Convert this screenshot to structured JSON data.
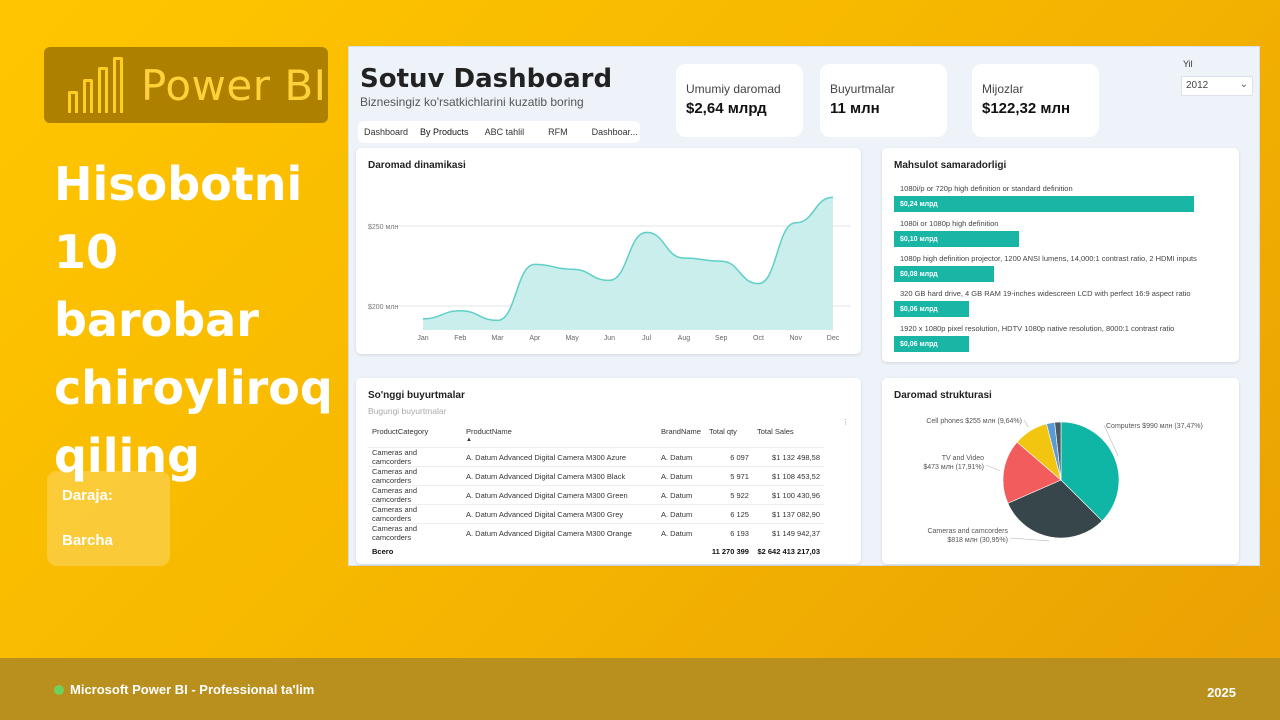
{
  "logo": {
    "text": "Power BI",
    "icon": "power-bi-logo-icon",
    "color": "#ffd23a"
  },
  "headline": {
    "lines": [
      "Hisobotni",
      "10 barobar",
      "chiroyliroq",
      "qiling"
    ]
  },
  "level": {
    "label": "Daraja:",
    "value": "Barcha"
  },
  "footer": {
    "left": "Microsoft Power BI  -  Professional ta'lim",
    "year": "2025",
    "dot_color": "#6fd05c"
  },
  "dashboard": {
    "title": "Sotuv Dashboard",
    "subtitle": "Biznesingiz ko'rsatkichlarini kuzatib boring",
    "tabs": [
      "Dashboard",
      "By Products",
      "ABC tahlil",
      "RFM",
      "Dashboar..."
    ],
    "kpis": [
      {
        "label": "Umumiy daromad",
        "value": "$2,64 млрд"
      },
      {
        "label": "Buyurtmalar",
        "value": "11 млн"
      },
      {
        "label": "Mijozlar",
        "value": "$122,32 млн"
      }
    ],
    "year_filter": {
      "label": "Yil",
      "value": "2012"
    },
    "revenue_chart": {
      "title": "Daromad dinamikasi",
      "color": "#5fcfc7"
    },
    "products": {
      "title": "Mahsulot samaradorligi",
      "color": "#19b6a6",
      "items": [
        {
          "label": "1080i/p or 720p high definition or standard definition",
          "value_label": "$0,24 млрд",
          "value": 0.24
        },
        {
          "label": "1080i or 1080p high definition",
          "value_label": "$0,10 млрд",
          "value": 0.1
        },
        {
          "label": "1080p high definition projector, 1200 ANSI lumens, 14,000:1 contrast ratio, 2 HDMI inputs",
          "value_label": "$0,08 млрд",
          "value": 0.08
        },
        {
          "label": "320 GB hard drive, 4 GB RAM 19-inches widescreen LCD with perfect 16:9 aspect ratio",
          "value_label": "$0,06 млрд",
          "value": 0.06
        },
        {
          "label": "1920 x 1080p pixel resolution, HDTV 1080p native resolution, 8000:1 contrast ratio",
          "value_label": "$0,06 млрд",
          "value": 0.06
        }
      ]
    },
    "orders": {
      "title": "So'nggi buyurtmalar",
      "subtitle": "Bugungi buyurtmalar",
      "columns": [
        "ProductCategory",
        "ProductName",
        "BrandName",
        "Total qty",
        "Total Sales"
      ],
      "rows": [
        [
          "Cameras and camcorders",
          "A. Datum Advanced Digital Camera M300 Azure",
          "A. Datum",
          "6 097",
          "$1 132 498,58"
        ],
        [
          "Cameras and camcorders",
          "A. Datum Advanced Digital Camera M300 Black",
          "A. Datum",
          "5 971",
          "$1 108 453,52"
        ],
        [
          "Cameras and camcorders",
          "A. Datum Advanced Digital Camera M300 Green",
          "A. Datum",
          "5 922",
          "$1 100 430,96"
        ],
        [
          "Cameras and camcorders",
          "A. Datum Advanced Digital Camera M300 Grey",
          "A. Datum",
          "6 125",
          "$1 137 082,90"
        ],
        [
          "Cameras and camcorders",
          "A. Datum Advanced Digital Camera M300 Orange",
          "A. Datum",
          "6 193",
          "$1 149 942,37"
        ]
      ],
      "total": {
        "label": "Всего",
        "qty": "11 270 399",
        "sales": "$2 642 413 217,03"
      }
    },
    "structure": {
      "title": "Daromad strukturasi"
    }
  },
  "chart_data": [
    {
      "type": "area",
      "title": "Daromad dinamikasi",
      "categories": [
        "Jan",
        "Feb",
        "Mar",
        "Apr",
        "May",
        "Jun",
        "Jul",
        "Aug",
        "Sep",
        "Oct",
        "Nov",
        "Dec"
      ],
      "values": [
        192,
        197,
        191,
        226,
        223,
        216,
        246,
        230,
        228,
        214,
        252,
        268
      ],
      "y_ticks": [
        200,
        250
      ],
      "y_tick_labels": [
        "$200 млн",
        "$250 млн"
      ],
      "ylim": [
        185,
        275
      ],
      "grid": true
    },
    {
      "type": "bar",
      "title": "Mahsulot samaradorligi",
      "orientation": "horizontal",
      "categories": [
        "1080i/p or 720p high definition or standard definition",
        "1080i or 1080p high definition",
        "1080p high definition projector, 1200 ANSI lumens, 14,000:1 contrast ratio, 2 HDMI inputs",
        "320 GB hard drive, 4 GB RAM 19-inches widescreen LCD with perfect 16:9 aspect ratio",
        "1920 x 1080p pixel resolution, HDTV 1080p native resolution, 8000:1 contrast ratio"
      ],
      "values": [
        0.24,
        0.1,
        0.08,
        0.06,
        0.06
      ],
      "data_labels": [
        "$0,24 млрд",
        "$0,10 млрд",
        "$0,08 млрд",
        "$0,06 млрд",
        "$0,06 млрд"
      ]
    },
    {
      "type": "pie",
      "title": "Daromad strukturasi",
      "slices": [
        {
          "name": "Computers",
          "value": 990,
          "percent": 37.47,
          "label": "Computers $990 млн (37,47%)",
          "color": "#0fb5a5"
        },
        {
          "name": "Cameras and camcorders",
          "value": 818,
          "percent": 30.95,
          "label": "Cameras and camcorders $818 млн (30,95%)",
          "color": "#37464a"
        },
        {
          "name": "TV and Video",
          "value": 473,
          "percent": 17.91,
          "label": "TV and Video $473 млн (17,91%)",
          "color": "#f25c5c"
        },
        {
          "name": "Cell phones",
          "value": 255,
          "percent": 9.64,
          "label": "Cell phones $255 млн (9,64%)",
          "color": "#f2c511"
        },
        {
          "name": "Other 1",
          "value": 60,
          "percent": 2.3,
          "label": "",
          "color": "#5b9bd5"
        },
        {
          "name": "Other 2",
          "value": 46,
          "percent": 1.73,
          "label": "",
          "color": "#4a5a63"
        }
      ]
    }
  ]
}
